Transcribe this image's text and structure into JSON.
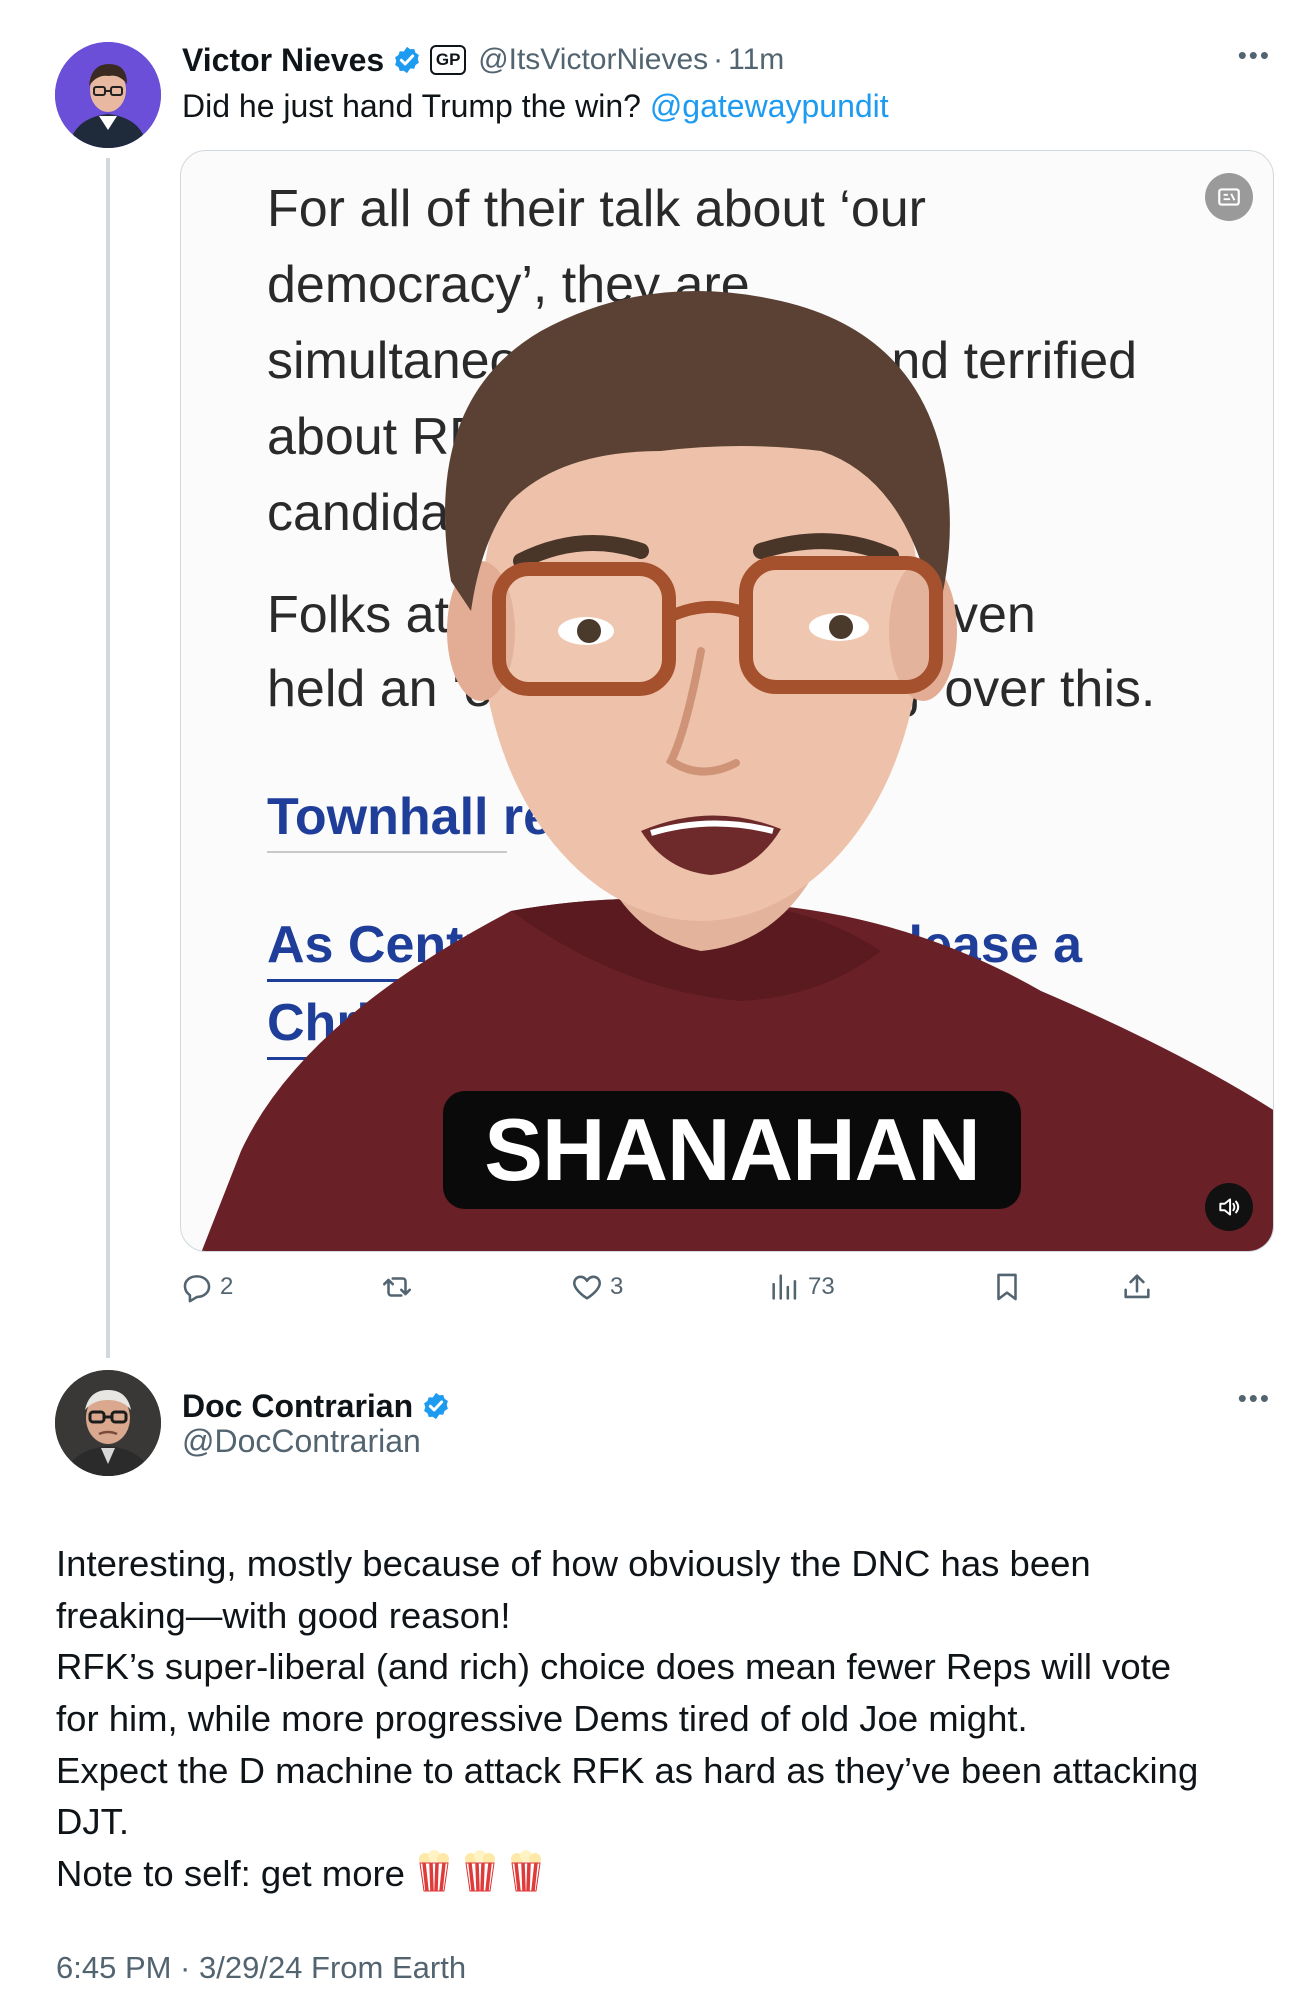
{
  "tweet": {
    "author_name": "Victor Nieves",
    "affiliate_badge": "GP",
    "handle": "@ItsVictorNieves",
    "separator": "·",
    "time": "11m",
    "text": "Did he just hand Trump the win?",
    "mention": "@gatewaypundit",
    "media": {
      "background_lines": [
        "For all of their talk about ‘our",
        "democracy’, they are",
        "simultaneously obsessed and terrified",
        "about RFK’s third-party",
        "candidacy.",
        "Folks at the DNC reportedly even",
        "held an ‘emergency meeting’ over this."
      ],
      "article_link": "Townhall reports:",
      "headline_lines": [
        "As Centrist Democrats Release a",
        "Christ"
      ],
      "caption": "SHANAHAN",
      "icons": [
        "gif-icon",
        "volume-icon"
      ]
    },
    "actions": {
      "replies": "2",
      "retweets": "",
      "likes": "3",
      "views": "73"
    }
  },
  "reply": {
    "author_name": "Doc Contrarian",
    "handle": "@DocContrarian",
    "body_lines": [
      "Interesting, mostly because of how obviously the DNC has been",
      "freaking—with good reason!",
      "RFK’s super-liberal (and rich) choice does mean fewer Reps will vote",
      "for him, while more progressive Dems tired of old Joe might.",
      "Expect the D machine to attack RFK as hard as they’ve been attacking",
      "DJT.",
      "Note to self: get more"
    ],
    "emoji": "popcorn",
    "emoji_count": 3,
    "timestamp": "6:45 PM · 3/29/24 From Earth"
  },
  "colors": {
    "accent": "#1d9bf0",
    "secondary_text": "#536471",
    "primary_text": "#0f1419",
    "shirt": "#6a2027"
  }
}
